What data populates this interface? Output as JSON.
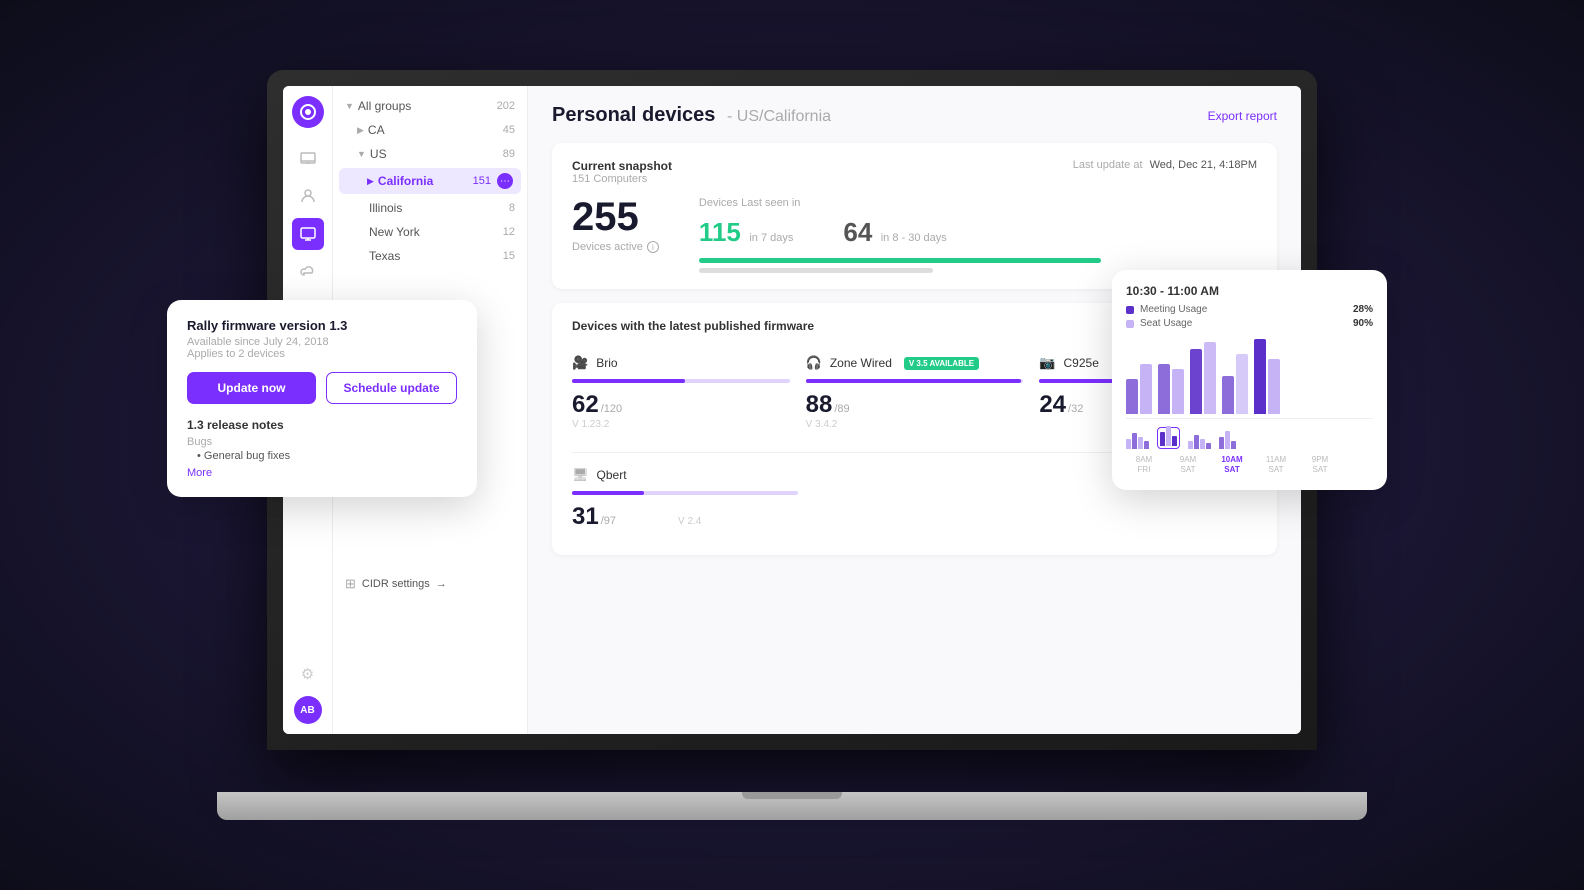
{
  "laptop": {
    "screen_bg": "#f9f9fb"
  },
  "sidebar": {
    "icons": [
      {
        "name": "logo-icon",
        "label": "Logo",
        "active": true
      },
      {
        "name": "devices-icon",
        "label": "Devices",
        "active": false
      },
      {
        "name": "users-icon",
        "label": "Users",
        "active": false
      },
      {
        "name": "monitor-icon",
        "label": "Monitor",
        "active": true
      },
      {
        "name": "cloud-icon",
        "label": "Cloud",
        "active": false
      }
    ],
    "gear_label": "⚙",
    "avatar_label": "AB"
  },
  "groups": {
    "items": [
      {
        "label": "All groups",
        "count": "202",
        "indent": 0,
        "expanded": true
      },
      {
        "label": "CA",
        "count": "45",
        "indent": 1,
        "expanded": false
      },
      {
        "label": "US",
        "count": "89",
        "indent": 1,
        "expanded": true
      },
      {
        "label": "California",
        "count": "151",
        "indent": 2,
        "selected": true
      },
      {
        "label": "Illinois",
        "count": "8",
        "indent": 2
      },
      {
        "label": "New York",
        "count": "12",
        "indent": 2
      },
      {
        "label": "Texas",
        "count": "15",
        "indent": 2
      }
    ]
  },
  "header": {
    "title": "Personal devices",
    "subtitle": "- US/California",
    "export_label": "Export report"
  },
  "snapshot": {
    "section_title": "Current snapshot",
    "computers_label": "151 Computers",
    "last_update_label": "Last update at",
    "last_update_value": "Wed, Dec 21, 4:18PM",
    "total_number": "255",
    "devices_active_label": "Devices active",
    "devices_seen_title": "Devices Last seen in",
    "green_number": "115",
    "green_label": "in 7 days",
    "gray_number": "64",
    "gray_label": "in 8 - 30 days"
  },
  "firmware_section": {
    "title": "Devices with the latest published firmware",
    "devices": [
      {
        "name": "Brio",
        "count": "62",
        "total": "120",
        "version": "V 1.23.2",
        "progress": 52,
        "badge": null
      },
      {
        "name": "Zone Wired",
        "count": "88",
        "total": "89",
        "version": "V 3.4.2",
        "progress": 99,
        "badge": "V 3.5 AVAILABLE"
      },
      {
        "name": "C925e",
        "count": "24",
        "total": "32",
        "version": "",
        "progress": 75,
        "badge": null
      }
    ],
    "devices_row2": [
      {
        "name": "Qbert",
        "count": "31",
        "total": "97",
        "version": "V 2.4",
        "progress": 32,
        "badge": null
      }
    ]
  },
  "floating_firmware": {
    "title": "Rally firmware version 1.3",
    "available_since": "Available since July 24, 2018",
    "applies_to": "Applies to 2 devices",
    "update_now_label": "Update now",
    "schedule_label": "Schedule update",
    "notes_title": "1.3 release notes",
    "bugs_label": "Bugs",
    "bug_item": "General bug fixes",
    "more_label": "More"
  },
  "floating_chart": {
    "time_label": "10:30 - 11:00 AM",
    "legend": [
      {
        "label": "Meeting Usage",
        "value": "28%",
        "color": "#5b2fc9"
      },
      {
        "label": "Seat Usage",
        "value": "90%",
        "color": "#c5b3f5"
      }
    ],
    "bars": [
      {
        "dark": 45,
        "light": 60
      },
      {
        "dark": 55,
        "light": 50
      },
      {
        "dark": 70,
        "light": 75
      },
      {
        "dark": 40,
        "light": 65
      },
      {
        "dark": 80,
        "light": 55
      }
    ],
    "day_labels": [
      "8AM\nFRi",
      "9AM\nSAT",
      "10AM\nSAT",
      "11AM\nSAT",
      "9PM\nSAT"
    ]
  },
  "cidr": {
    "label": "CIDR settings",
    "arrow": "→"
  }
}
